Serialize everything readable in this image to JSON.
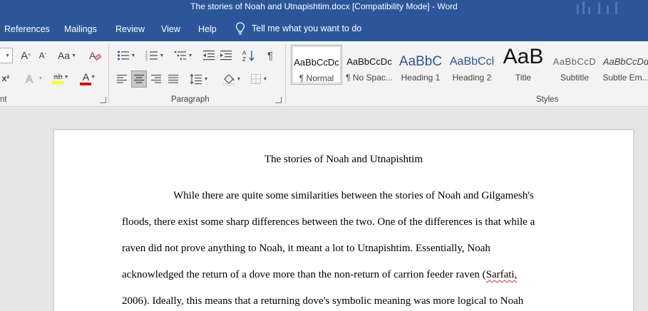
{
  "window": {
    "title": "The stories of Noah and Utnapishtim.docx [Compatibility Mode]  -  Word"
  },
  "tabs": [
    "References",
    "Mailings",
    "Review",
    "View",
    "Help"
  ],
  "tell_me": "Tell me what you want to do",
  "ribbon": {
    "font_group_label": "nt",
    "paragraph_group_label": "Paragraph",
    "styles_group_label": "Styles",
    "font": {
      "grow_glyph": "A",
      "shrink_glyph": "A",
      "case_glyph": "Aa",
      "superscript_glyph": "x²",
      "font_color_glyph": "A",
      "highlight_glyph": "ab"
    },
    "paragraph": {
      "pilcrow_glyph": "¶"
    }
  },
  "styles": [
    {
      "sample": "AaBbCcDc",
      "name": "¶ Normal",
      "selected": true
    },
    {
      "sample": "AaBbCcDc",
      "name": "¶ No Spac..."
    },
    {
      "sample": "AaBbC",
      "name": "Heading 1"
    },
    {
      "sample": "AaBbCcl",
      "name": "Heading 2"
    },
    {
      "sample": "AaB",
      "name": "Title"
    },
    {
      "sample": "AaBbCcD",
      "name": "Subtitle"
    },
    {
      "sample": "AaBbCcDd",
      "name": "Subtle Em..."
    }
  ],
  "document": {
    "title": "The stories of Noah and Utnapishtim",
    "lines": [
      "While there are quite some similarities between the stories of Noah and Gilgamesh's",
      "floods, there exist some sharp differences between the two. One of the differences is that while a",
      "raven did not prove anything to Noah, it meant a lot to Utnapishtim. Essentially, Noah",
      "acknowledged the return of a dove more than the non-return of carrion feeder raven (",
      "2006). Ideally, this means that a returning dove's symbolic meaning was more logical to Noah"
    ],
    "citation": "Sarfati,"
  },
  "colors": {
    "accent": "#2b579a",
    "ribbon_bg": "#f3f3f3",
    "canvas_bg": "#e6e6e6",
    "font_color_bar": "#e00000",
    "highlight_bar": "#ffff00",
    "heading_blue": "#2f5496"
  }
}
